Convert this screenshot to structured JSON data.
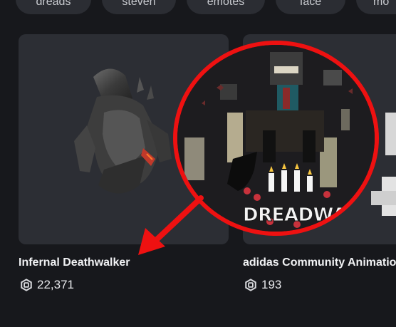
{
  "chips": [
    {
      "label": "dreads"
    },
    {
      "label": "steven"
    },
    {
      "label": "emotes"
    },
    {
      "label": "face"
    },
    {
      "label": "mo"
    }
  ],
  "items": [
    {
      "name": "Infernal Deathwalker",
      "price": "22,371"
    },
    {
      "name": "adidas Community Animatio",
      "price": "193"
    }
  ],
  "zoom": {
    "logo_text": "DREADWALKER"
  },
  "colors": {
    "background": "#17181c",
    "card": "#2c2e34",
    "chip": "#2b2d33",
    "highlight": "#ee1111"
  },
  "icons": {
    "currency": "robux-icon"
  }
}
